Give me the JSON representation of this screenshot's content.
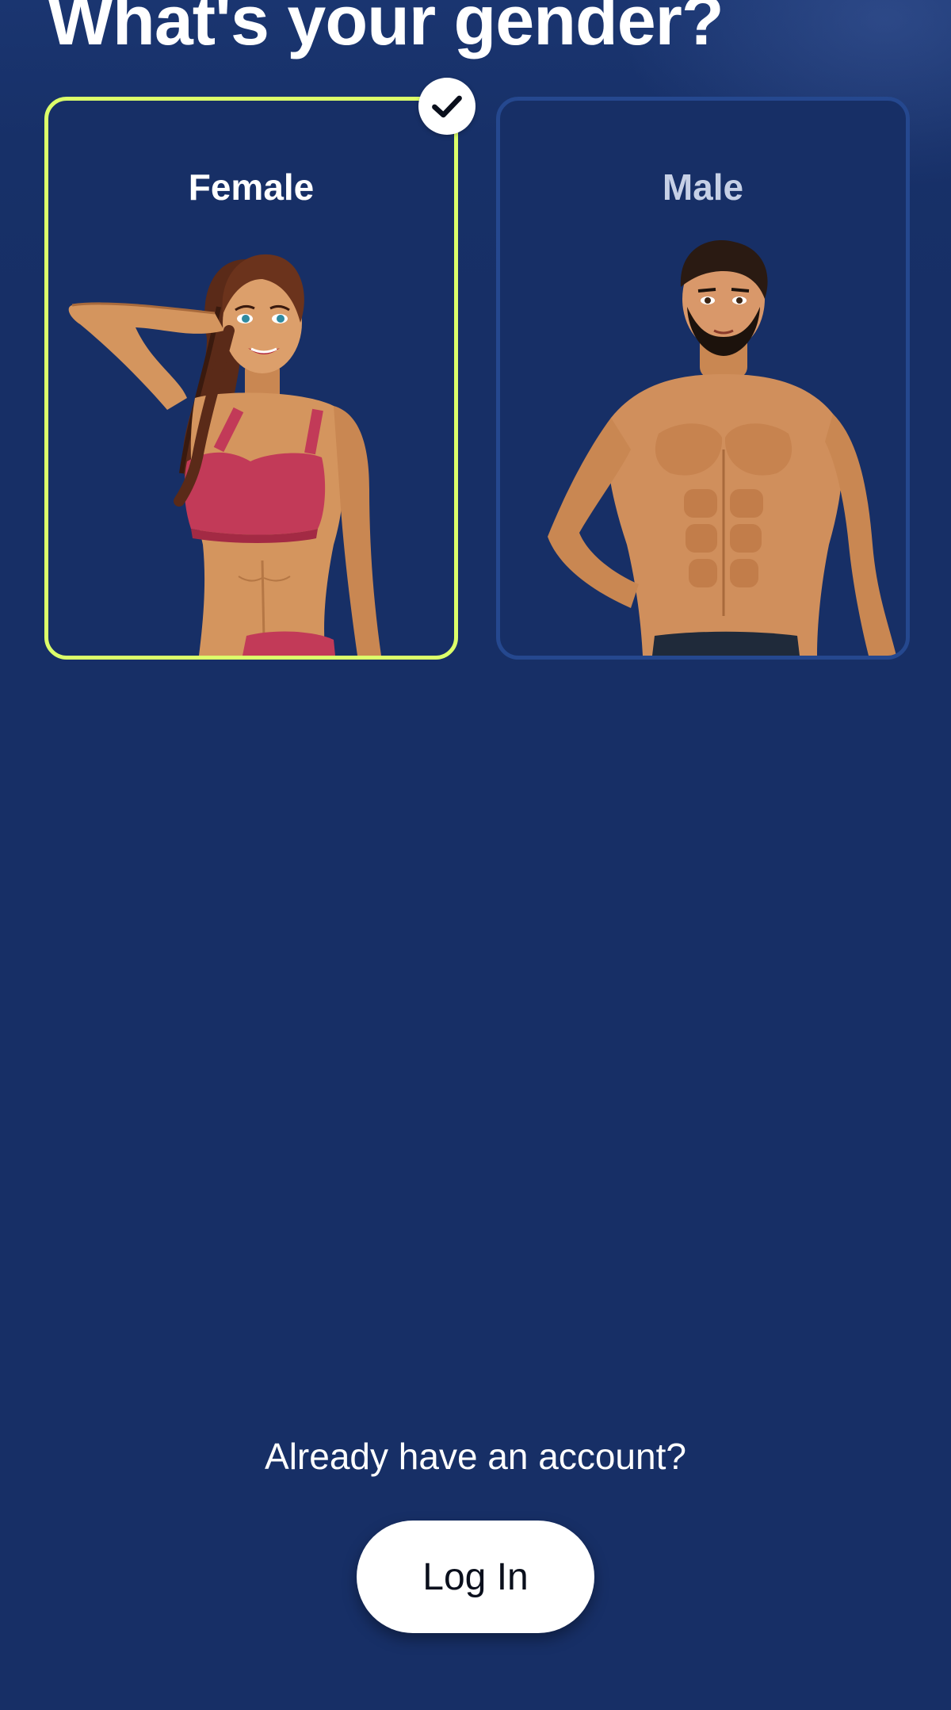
{
  "page": {
    "title": "What's your gender?"
  },
  "options": [
    {
      "label": "Female",
      "selected": true,
      "illustration": "female-fitness-illustration"
    },
    {
      "label": "Male",
      "selected": false,
      "illustration": "male-fitness-illustration"
    }
  ],
  "footer": {
    "prompt": "Already have an account?",
    "login_label": "Log In"
  },
  "colors": {
    "background": "#172f66",
    "selected_border": "#dcff6a",
    "unselected_border": "#25488f",
    "button_bg": "#ffffff"
  },
  "icons": {
    "selected_check": "checkmark-icon"
  }
}
